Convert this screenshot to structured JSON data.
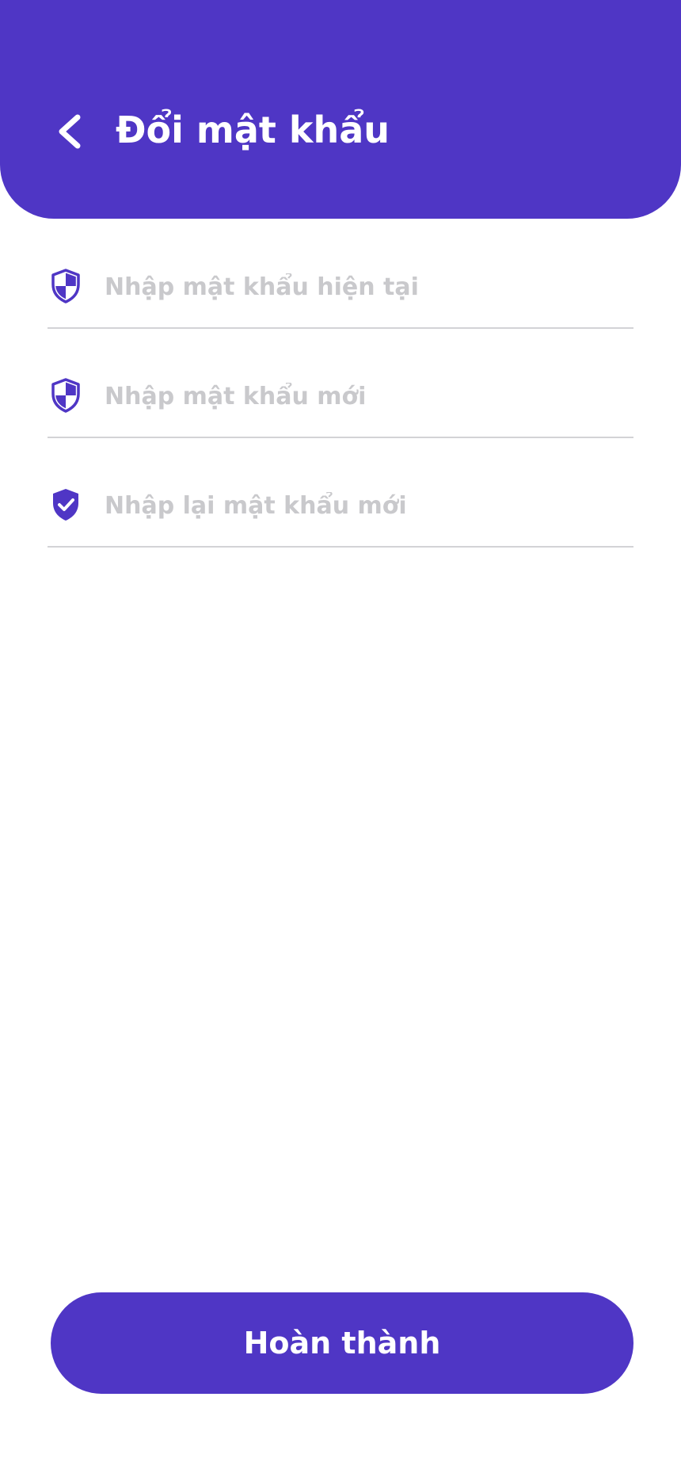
{
  "header": {
    "title": "Đổi mật khẩu",
    "back_icon": "chevron-left-icon"
  },
  "form": {
    "fields": [
      {
        "placeholder": "Nhập mật khẩu hiện tại",
        "value": "",
        "icon": "shield-icon"
      },
      {
        "placeholder": "Nhập mật khẩu mới",
        "value": "",
        "icon": "shield-icon"
      },
      {
        "placeholder": "Nhập lại mật khẩu mới",
        "value": "",
        "icon": "shield-check-icon"
      }
    ]
  },
  "actions": {
    "submit_label": "Hoàn thành"
  },
  "colors": {
    "primary": "#4f36c5",
    "placeholder": "#c9c9cc",
    "divider": "#d3d3d6",
    "background": "#ffffff"
  }
}
